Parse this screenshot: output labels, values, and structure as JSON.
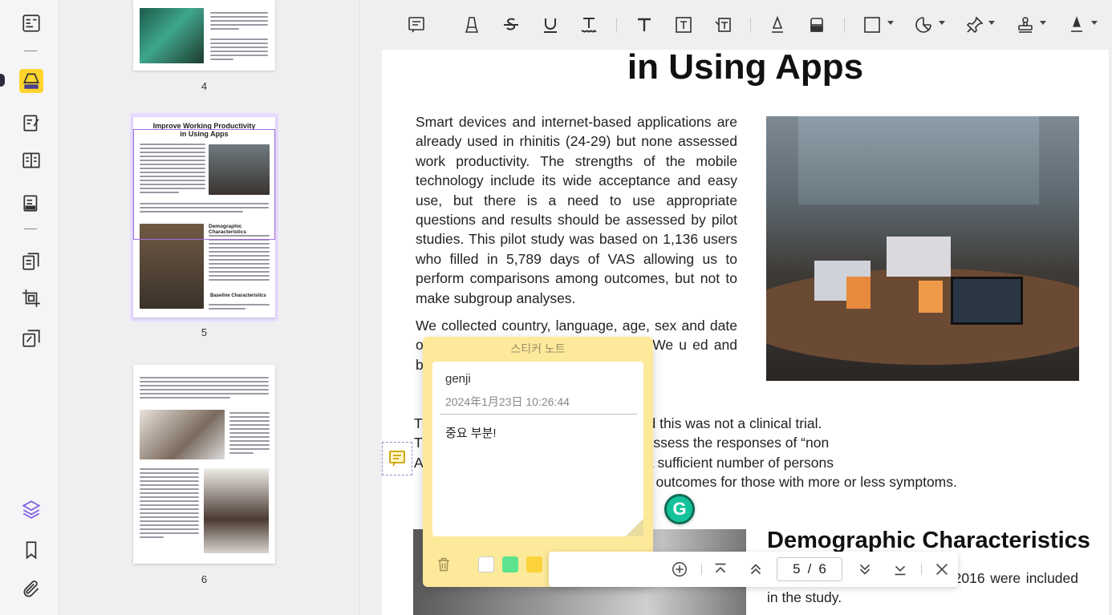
{
  "thumbnails": {
    "pages": [
      {
        "number": "4"
      },
      {
        "number": "5",
        "title": "Improve Working Productivity in Using Apps",
        "heading_demo": "Demographic Characteristics",
        "heading_base": "Baseline Characteristics"
      },
      {
        "number": "6"
      }
    ]
  },
  "document": {
    "title": "in Using Apps",
    "para1": "Smart devices and internet-based applications are already used in rhinitis (24-29) but none assessed work productivity. The strengths of the mobile technology include its wide acceptance and easy use, but there is a need to use appropriate questions and results should be assessed by pilot studies. This pilot study was based on 1,136 users who filled in 5,789 days of VAS allowing us to perform comparisons among outcomes, but not to make subgroup analyses.",
    "para2": "We collected country, language, age, sex and date of entry of information with the App. We u                                    ed and back-tr",
    "para3_lines": [
      "T                                                        AR patients with control subjects and this was not a clinical trial.",
      "T                                                        eported “AR” and we are unable to assess the responses of “non",
      "A                                                        re many days with no symptoms in a sufficient number of persons",
      "                                                         en outcomes for those with more or less symptoms."
    ],
    "heading_demo": "Demographic Characteristics",
    "para4": "June 1, 2016 to October 31, 2016 were included in the study."
  },
  "sticky_note": {
    "title": "스티커 노트",
    "author": "genji",
    "date": "2024年1月23日 10:26:44",
    "text": "중요 부분!",
    "colors": [
      "#ffffff",
      "#5de38e",
      "#fcd23a",
      "#52c8f2",
      "#c8a4f5",
      "#fb9fc4",
      "#fbaa82"
    ]
  },
  "navigator": {
    "current_page": "5",
    "separator": "/",
    "total_pages": "6"
  },
  "grammarly": {
    "label": "G"
  }
}
